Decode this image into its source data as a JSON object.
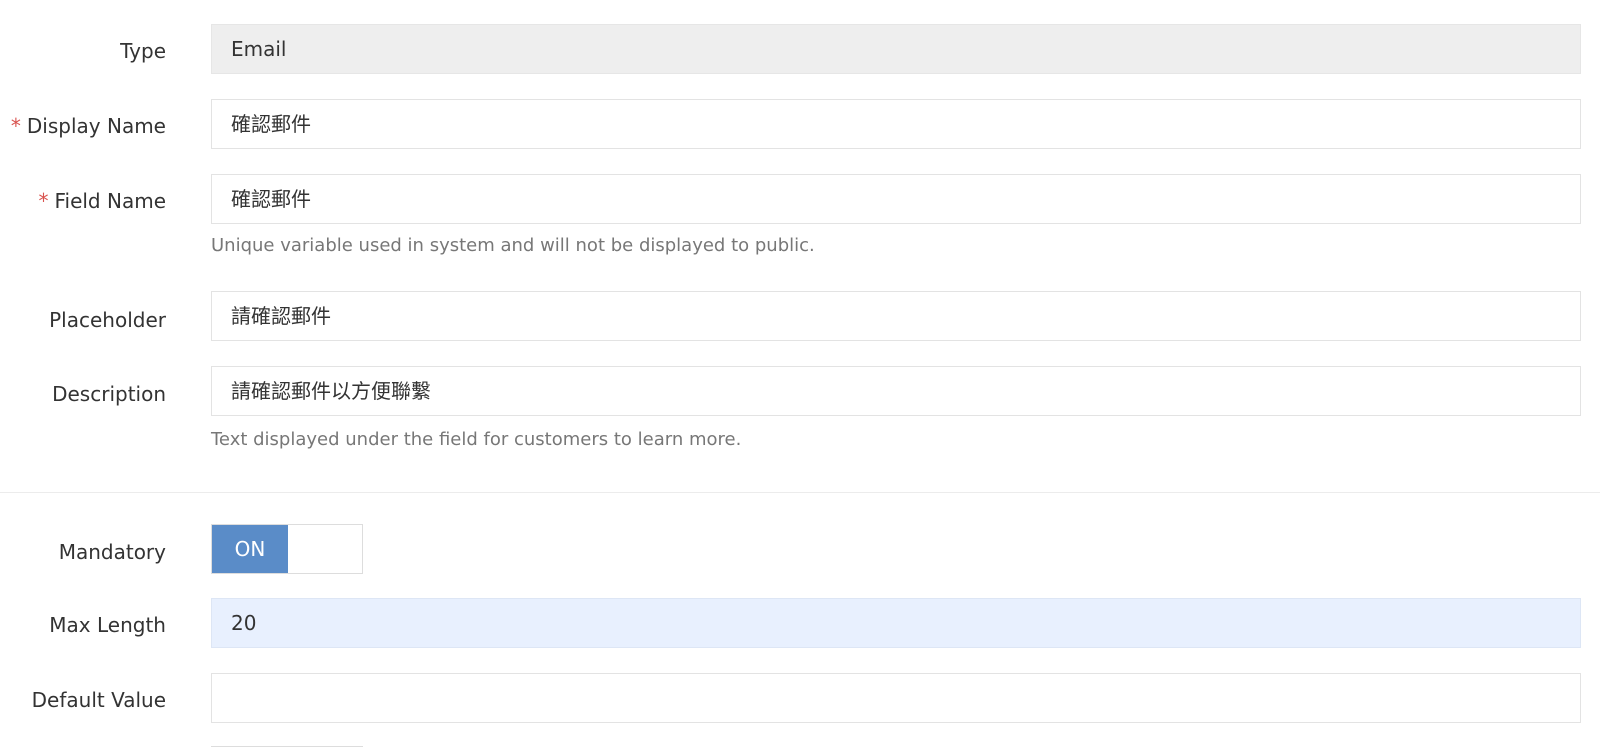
{
  "form": {
    "type": {
      "label": "Type",
      "value": "Email"
    },
    "display_name": {
      "required_mark": "*",
      "label": "Display Name",
      "value": "確認郵件"
    },
    "field_name": {
      "required_mark": "*",
      "label": "Field Name",
      "value": "確認郵件",
      "help": "Unique variable used in system and will not be displayed to public."
    },
    "placeholder": {
      "label": "Placeholder",
      "value": "請確認郵件"
    },
    "description": {
      "label": "Description",
      "value": "請確認郵件以方便聯繫",
      "help": "Text displayed under the field for customers to learn more."
    },
    "mandatory": {
      "label": "Mandatory",
      "state_label": "ON",
      "enabled": true
    },
    "max_length": {
      "label": "Max Length",
      "value": "20"
    },
    "default_value": {
      "label": "Default Value",
      "value": ""
    }
  },
  "colors": {
    "required": "#d9534f",
    "toggle_on": "#5a8cc8",
    "highlight_field": "#e8f0fe",
    "readonly_field": "#eeeeee"
  }
}
